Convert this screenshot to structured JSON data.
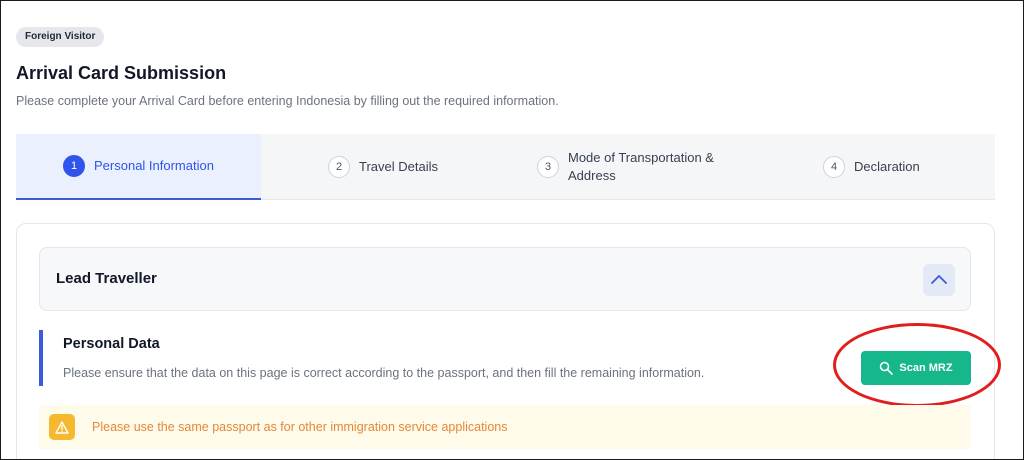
{
  "badge": "Foreign Visitor",
  "header": {
    "title": "Arrival Card Submission",
    "subtitle": "Please complete your Arrival Card before entering Indonesia by filling out the required information."
  },
  "steps": [
    {
      "num": "1",
      "label": "Personal Information",
      "active": true
    },
    {
      "num": "2",
      "label": "Travel Details",
      "active": false
    },
    {
      "num": "3",
      "label": "Mode of Transportation & Address",
      "active": false
    },
    {
      "num": "4",
      "label": "Declaration",
      "active": false
    }
  ],
  "section": {
    "title": "Lead Traveller",
    "collapse_icon": "chevron-up-icon"
  },
  "personal_data": {
    "title": "Personal Data",
    "description": "Please ensure that the data on this page is correct according to the passport, and then fill the remaining information."
  },
  "scan_button": {
    "label": "Scan MRZ",
    "icon": "search-icon"
  },
  "warning": {
    "icon": "warning-icon",
    "text": "Please use the same passport as for other immigration service applications"
  },
  "colors": {
    "primary": "#2f54eb",
    "scan_button": "#16b78a",
    "highlight": "#e11d1d",
    "warning_bg": "#fffbea",
    "warning_text": "#e3883a"
  }
}
